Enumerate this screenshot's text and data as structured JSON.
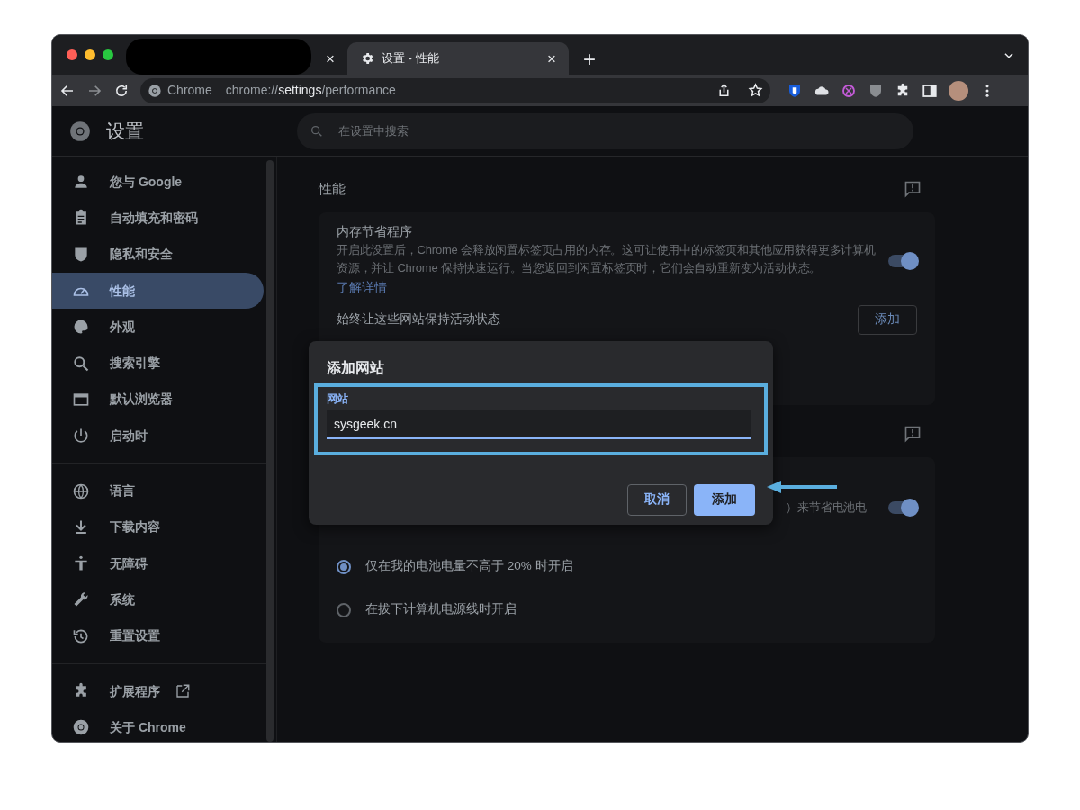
{
  "browser": {
    "tabs": [
      {
        "kind": "redacted",
        "close": "×",
        "selected": false
      },
      {
        "kind": "page",
        "title": "设置 - 性能",
        "close": "×",
        "selected": true
      }
    ],
    "new_tab": "+",
    "omnibox": {
      "chip": "Chrome",
      "url": "chrome://**settings**/performance"
    }
  },
  "settings": {
    "title": "设置",
    "search": {
      "placeholder": "在设置中搜索"
    },
    "sidebar": {
      "groups": [
        {
          "items": [
            {
              "label": "您与 Google",
              "selected": false
            },
            {
              "label": "自动填充和密码",
              "selected": false
            },
            {
              "label": "隐私和安全",
              "selected": false
            },
            {
              "label": "性能",
              "selected": true
            },
            {
              "label": "外观",
              "selected": false
            },
            {
              "label": "搜索引擎",
              "selected": false
            },
            {
              "label": "默认浏览器",
              "selected": false
            },
            {
              "label": "启动时",
              "selected": false
            }
          ]
        },
        {
          "items": [
            {
              "label": "语言",
              "selected": false
            },
            {
              "label": "下载内容",
              "selected": false
            },
            {
              "label": "无障碍",
              "selected": false
            },
            {
              "label": "系统",
              "selected": false
            },
            {
              "label": "重置设置",
              "selected": false
            }
          ]
        },
        {
          "items": [
            {
              "label": "扩展程序",
              "selected": false,
              "external": true
            },
            {
              "label": "关于 Chrome",
              "selected": false,
              "external": false
            }
          ]
        }
      ]
    },
    "section_title": "性能",
    "memory_saver": {
      "title": "内存节省程序",
      "description": "开启此设置后，Chrome 会释放闲置标签页占用的内存。这可让使用中的标签页和其他应用获得更多计算机资源，并让 Chrome 保持快速运行。当您返回到闲置标签页时，它们会自动重新变为活动状态。",
      "link": "了解详情",
      "on": true,
      "sites_label": "始终让这些网站保持活动状态",
      "add_button": "添加"
    },
    "battery_saver": {
      "description_visible": "）来节省电池电",
      "on": true,
      "options": [
        {
          "label": "仅在我的电池电量不高于 20% 时开启",
          "selected": true
        },
        {
          "label": "在拔下计算机电源线时开启",
          "selected": false
        }
      ]
    }
  },
  "dialog": {
    "title": "添加网站",
    "field_label": "网站",
    "value": "sysgeek.cn",
    "cancel": "取消",
    "confirm": "添加"
  }
}
